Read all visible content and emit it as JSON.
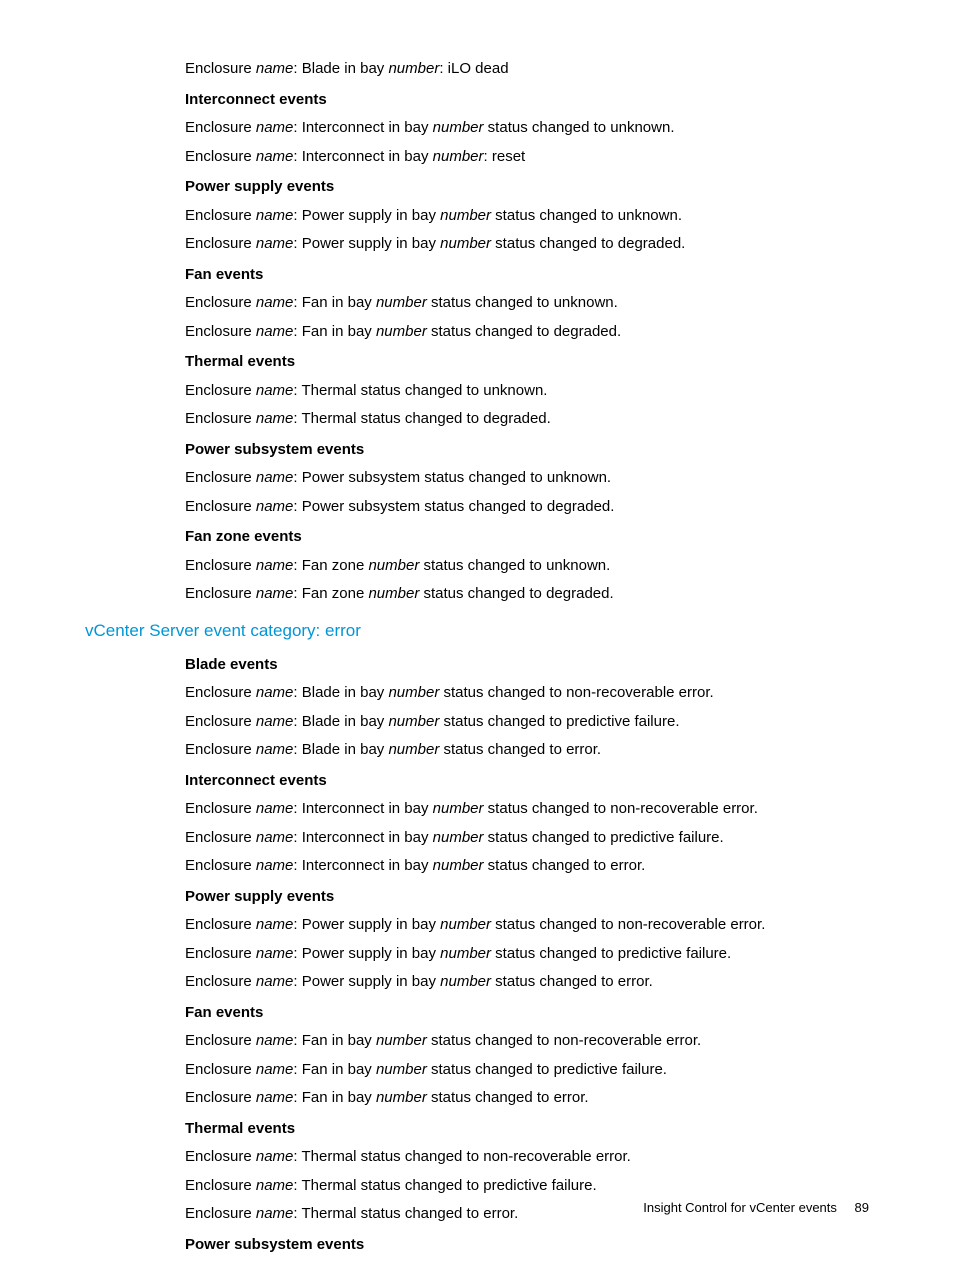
{
  "words": {
    "enclosure": "Enclosure",
    "name": "name",
    "number": "number",
    "colon": ":",
    "blade_in_bay": ": Blade in bay ",
    "interconnect_in_bay": ": Interconnect in bay ",
    "power_supply_in_bay": ": Power supply in bay ",
    "fan_in_bay": ": Fan in bay ",
    "fan_zone": ": Fan zone ",
    "thermal_prefix": ": Thermal status changed to ",
    "power_sub_prefix": ": Power subsystem status changed to ",
    "status_changed_to": " status changed to ",
    "ilo_dead": ": iLO dead",
    "reset": ": reset"
  },
  "statuses": {
    "unknown": "unknown.",
    "degraded": "degraded.",
    "nonrec": "non-recoverable error.",
    "predictive": "predictive failure.",
    "error": "error."
  },
  "headings": {
    "interconnect": "Interconnect events",
    "power_supply": "Power supply events",
    "fan": "Fan events",
    "thermal": "Thermal events",
    "power_sub": "Power subsystem events",
    "fan_zone": "Fan zone events",
    "blade": "Blade events"
  },
  "section": {
    "error": "vCenter Server event category: error"
  },
  "footer": {
    "text": "Insight Control for vCenter events",
    "page": "89"
  }
}
